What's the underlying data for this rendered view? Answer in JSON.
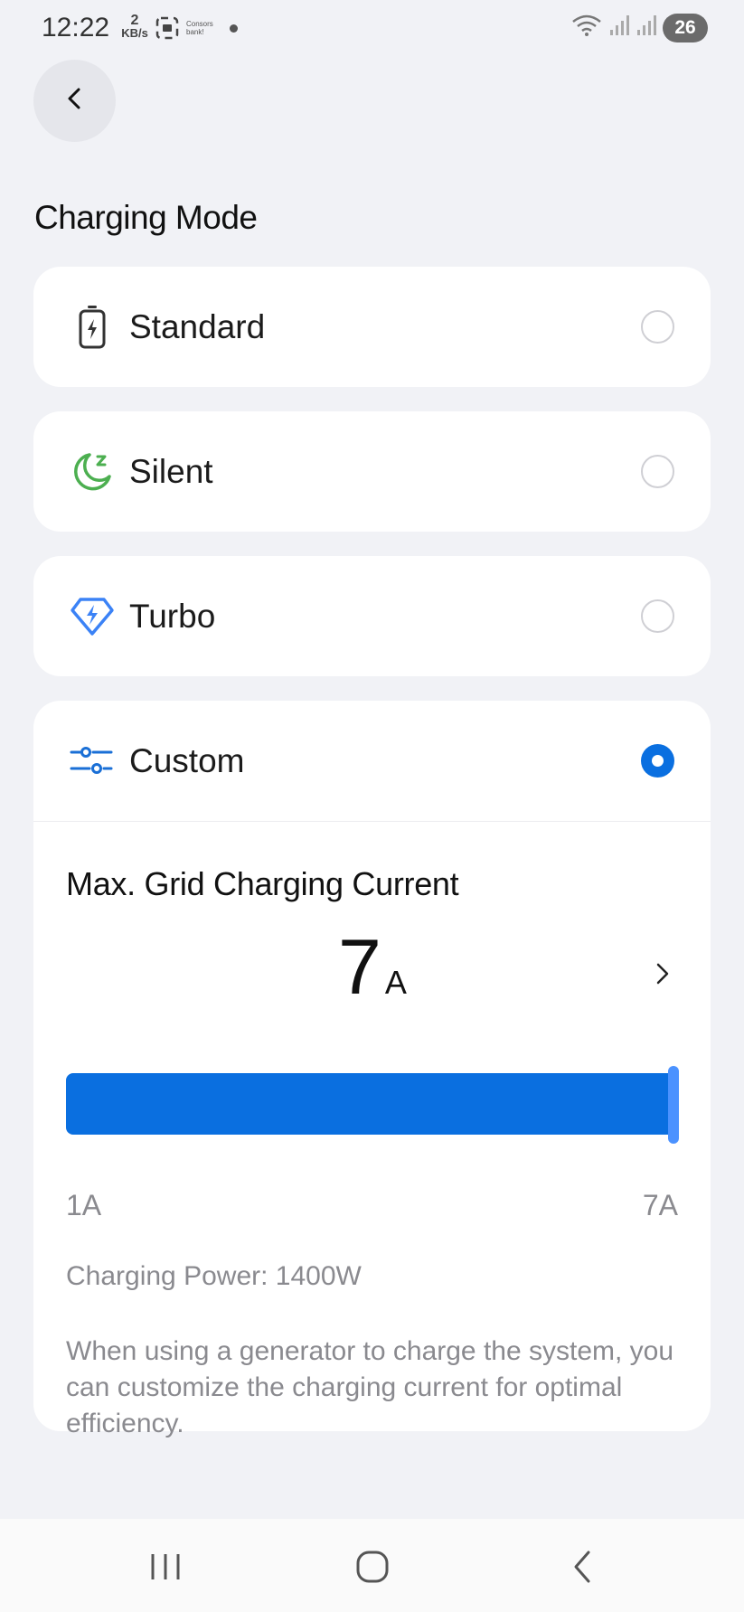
{
  "status_bar": {
    "time": "12:22",
    "kbs_value": "2",
    "kbs_unit": "KB/s",
    "app_notice": "Consors bank!",
    "battery": "26"
  },
  "header": {
    "back_icon": "chevron-left-icon",
    "title": "Charging Mode"
  },
  "options": [
    {
      "label": "Standard",
      "icon": "battery-bolt-icon",
      "selected": false
    },
    {
      "label": "Silent",
      "icon": "moon-sleep-icon",
      "selected": false
    },
    {
      "label": "Turbo",
      "icon": "diamond-bolt-icon",
      "selected": false
    },
    {
      "label": "Custom",
      "icon": "sliders-icon",
      "selected": true
    }
  ],
  "custom": {
    "section_title": "Max. Grid Charging Current",
    "current_value": "7",
    "current_unit": "A",
    "slider_min_label": "1A",
    "slider_max_label": "7A",
    "slider_fraction": 1.0,
    "charging_power": "Charging Power: 1400W",
    "description": "When using a generator to charge the system, you can customize the charging current for optimal efficiency."
  },
  "colors": {
    "accent": "#0a6fe0",
    "silent_icon": "#4caf50",
    "turbo_icon": "#3b82f6",
    "background": "#f1f2f6"
  },
  "nav": {
    "recents_icon": "recents-icon",
    "home_icon": "home-icon",
    "back_icon": "back-icon"
  }
}
